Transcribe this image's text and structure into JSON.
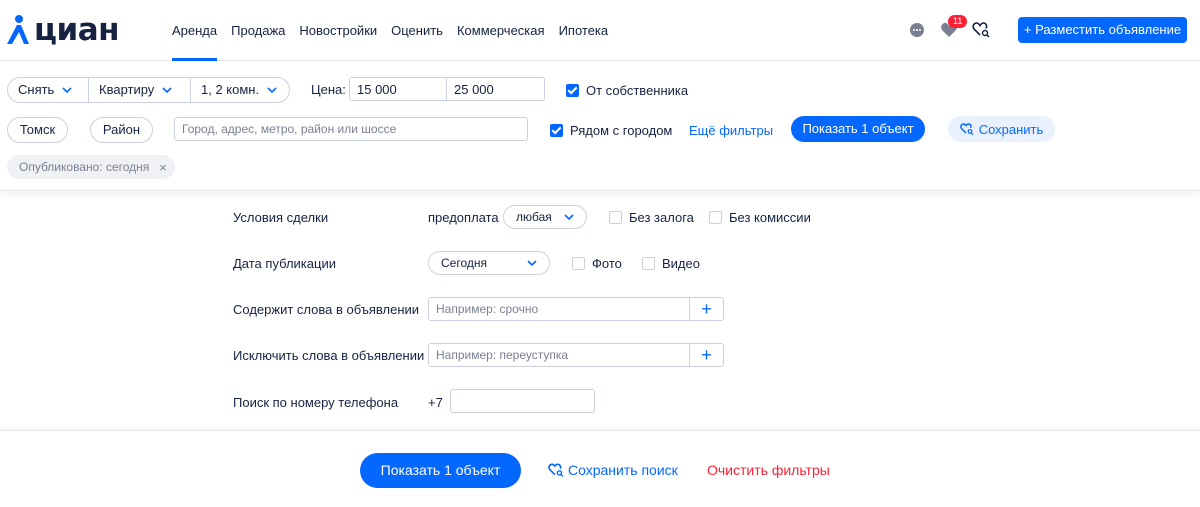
{
  "header": {
    "logo_text": "циан",
    "nav": [
      "Аренда",
      "Продажа",
      "Новостройки",
      "Оценить",
      "Коммерческая",
      "Ипотека"
    ],
    "active_nav": "Аренда",
    "favorites_count": "11",
    "place_ad_label": "+ Разместить объявление",
    "accent": "#0468ff"
  },
  "filters": {
    "deal_type": "Снять",
    "object_type": "Квартиру",
    "rooms": "1, 2 комн.",
    "price_label": "Цена:",
    "price_from": "15 000",
    "price_to": "25 000",
    "owner_label": "От собственника",
    "owner_checked": true,
    "city": "Томск",
    "district_label": "Район",
    "search_placeholder": "Город, адрес, метро, район или шоссе",
    "near_city_label": "Рядом с городом",
    "near_city_checked": true,
    "more_filters_label": "Ещё фильтры",
    "show_label": "Показать 1 объект",
    "save_label": "Сохранить",
    "chip_label": "Опубликовано: сегодня",
    "chip_close": "×"
  },
  "extended": {
    "deal_conditions_label": "Условия сделки",
    "prepay_label": "предоплата",
    "prepay_value": "любая",
    "no_deposit_label": "Без залога",
    "no_commission_label": "Без комиссии",
    "pub_date_label": "Дата публикации",
    "pub_date_value": "Сегодня",
    "photo_label": "Фото",
    "video_label": "Видео",
    "include_words_label": "Содержит слова в объявлении",
    "include_words_placeholder": "Например: срочно",
    "exclude_words_label": "Исключить слова в объявлении",
    "exclude_words_placeholder": "Например: переуступка",
    "add_symbol": "+",
    "phone_label": "Поиск по номеру телефона",
    "phone_prefix": "+7",
    "phone_value": ""
  },
  "footer": {
    "show_label": "Показать 1 объект",
    "save_search_label": "Сохранить поиск",
    "clear_label": "Очистить фильтры",
    "clear_color": "#ff1f34"
  }
}
